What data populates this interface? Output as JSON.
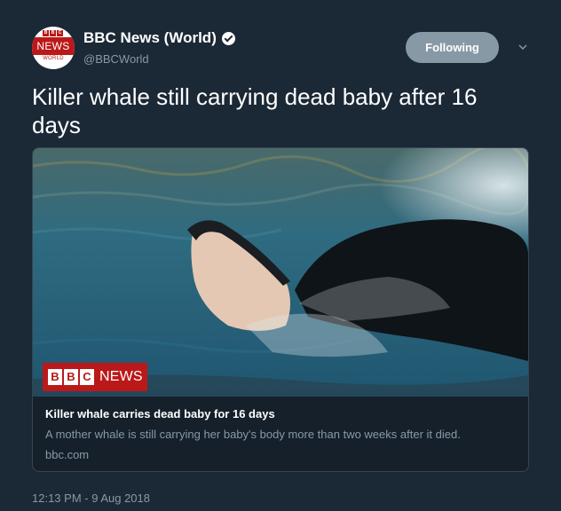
{
  "account": {
    "display_name": "BBC News (World)",
    "handle": "@BBCWorld",
    "avatar": {
      "top_letters": [
        "B",
        "B",
        "C"
      ],
      "band_text": "NEWS",
      "sub_text": "WORLD"
    },
    "verified_icon": "verified-badge-icon"
  },
  "follow_button": {
    "label": "Following"
  },
  "menu_icon": "chevron-down-icon",
  "tweet": {
    "text": "Killer whale still carrying dead baby after 16 days",
    "timestamp": "12:13 PM - 9 Aug 2018"
  },
  "card": {
    "image_logo": {
      "letters": [
        "B",
        "B",
        "C"
      ],
      "word": "NEWS"
    },
    "title": "Killer whale carries dead baby for 16 days",
    "description": "A mother whale is still carrying her baby's body more than two weeks after it died.",
    "domain": "bbc.com"
  },
  "colors": {
    "background": "#1b2836",
    "bbc_red": "#bb1919",
    "secondary_text": "#8899a6",
    "follow_button_bg": "#8899a6"
  }
}
